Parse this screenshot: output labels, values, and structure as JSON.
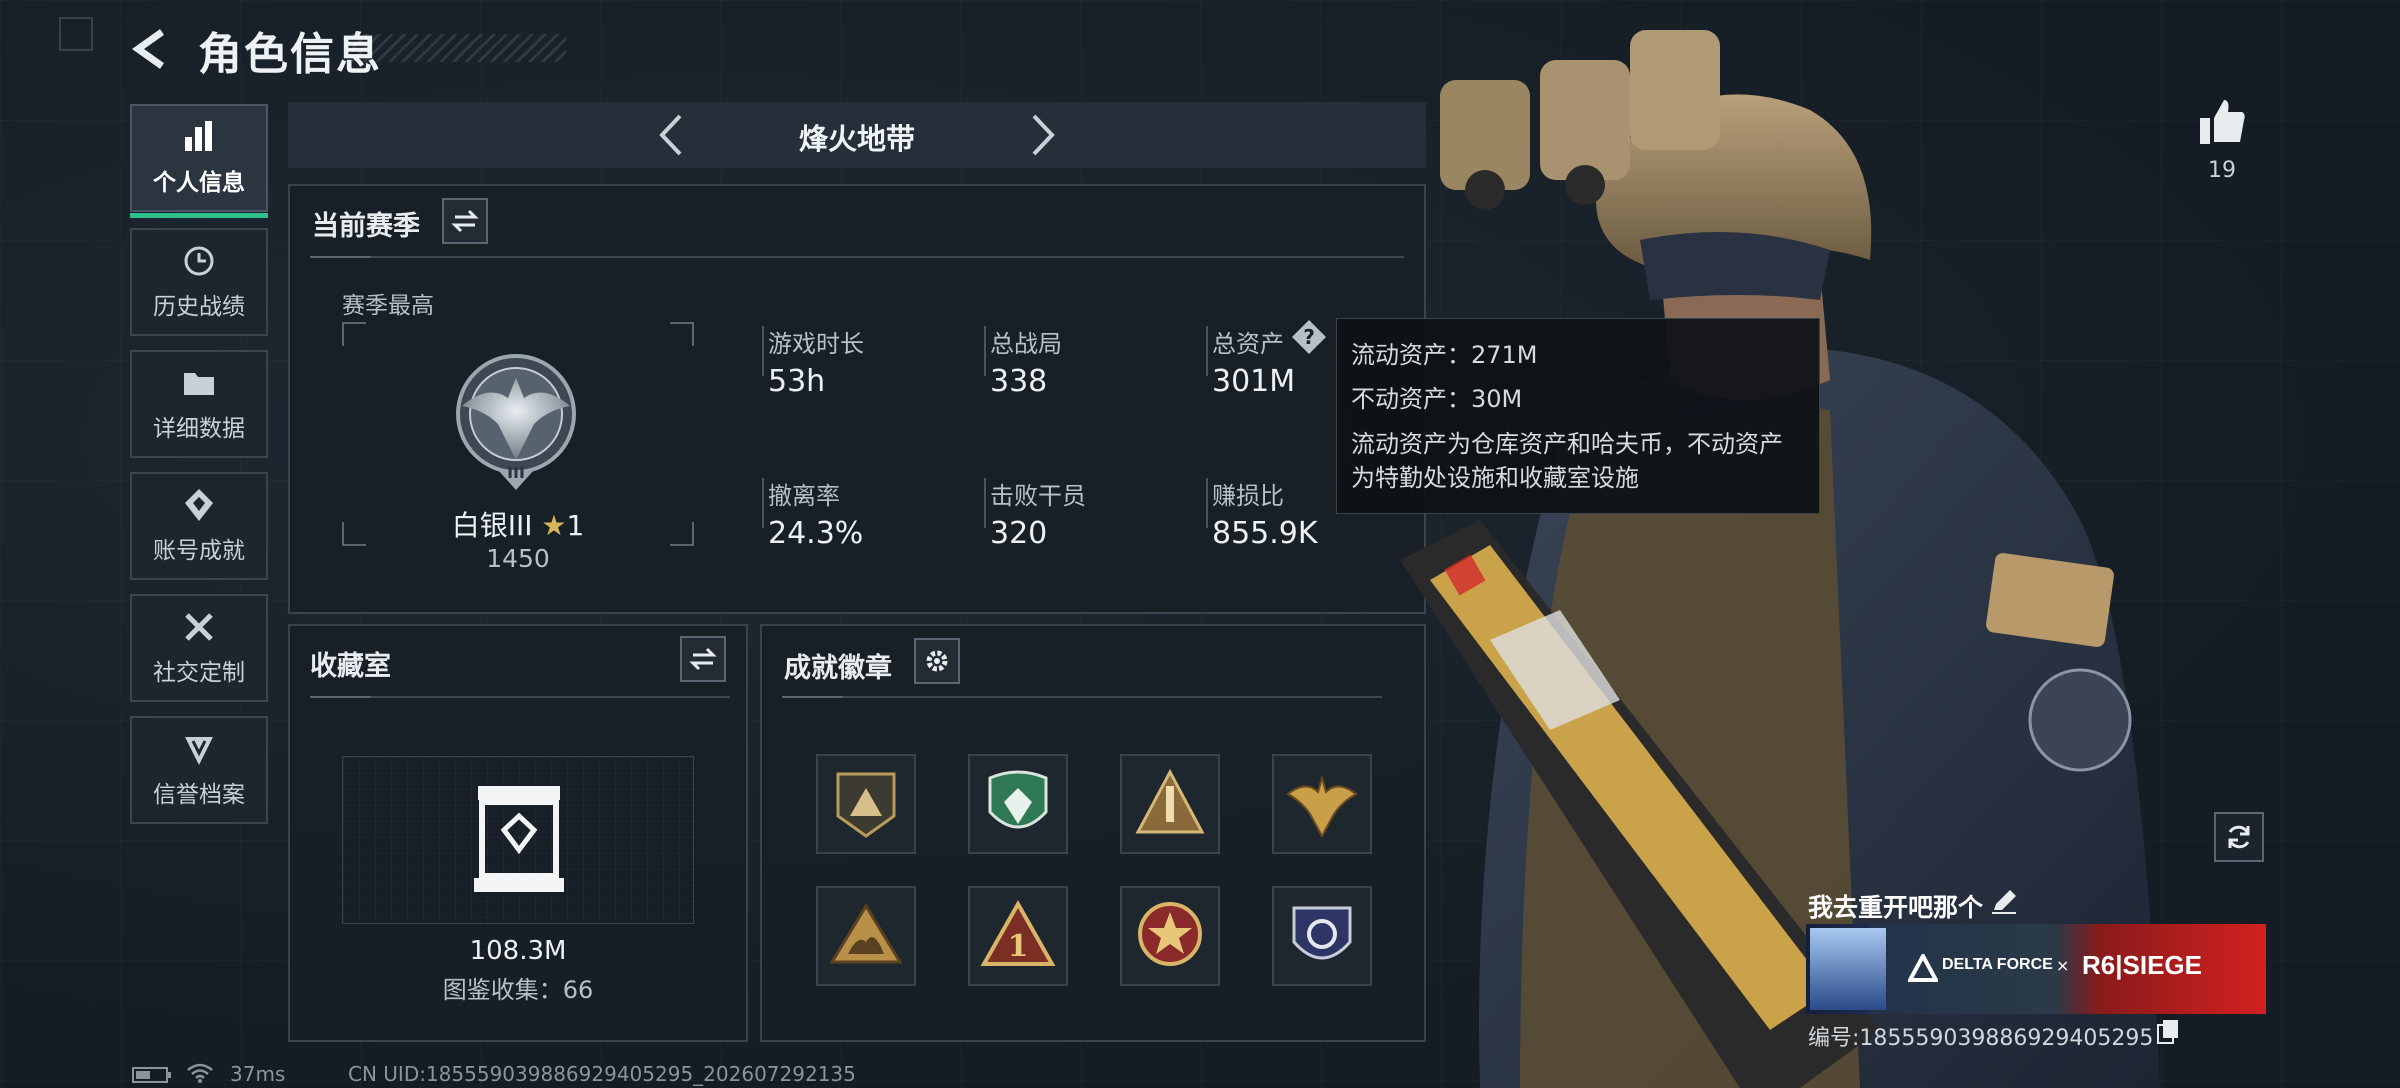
{
  "header": {
    "title": "角色信息"
  },
  "sidebar": {
    "items": [
      {
        "label": "个人信息",
        "icon": "bar-chart-icon",
        "active": true
      },
      {
        "label": "历史战绩",
        "icon": "history-clock-icon"
      },
      {
        "label": "详细数据",
        "icon": "folder-icon"
      },
      {
        "label": "账号成就",
        "icon": "achievement-icon"
      },
      {
        "label": "社交定制",
        "icon": "tools-icon"
      },
      {
        "label": "信誉档案",
        "icon": "shield-v-icon"
      }
    ]
  },
  "mode": {
    "title": "烽火地带"
  },
  "season": {
    "title": "当前赛季",
    "best_label": "赛季最高",
    "rank_name": "白银III",
    "rank_stars": "1",
    "rank_score": "1450",
    "stats": [
      {
        "label": "游戏时长",
        "value": "53h"
      },
      {
        "label": "总战局",
        "value": "338"
      },
      {
        "label": "总资产",
        "value": "301M"
      },
      {
        "label": "撤离率",
        "value": "24.3%"
      },
      {
        "label": "击败干员",
        "value": "320"
      },
      {
        "label": "赚损比",
        "value": "855.9K"
      }
    ]
  },
  "tooltip": {
    "liquid": "流动资产：271M",
    "fixed": "不动资产：30M",
    "desc_line1": "流动资产为仓库资产和哈夫币，不动资产",
    "desc_line2": "为特勤处设施和收藏室设施"
  },
  "collection": {
    "title": "收藏室",
    "value": "108.3M",
    "count": "图鉴收集：66"
  },
  "badges": {
    "title": "成就徽章",
    "items": [
      "delta-triangle-badge",
      "green-shield-badge",
      "rocket-badge",
      "eagle-badge",
      "camel-badge",
      "number-one-badge",
      "star-medal-badge",
      "blue-shield-badge"
    ]
  },
  "likes": {
    "count": "19"
  },
  "player": {
    "name": "我去重开吧那个",
    "id": "编号:1855590398869294052​95",
    "banner_text_1": "DELTA FORCE",
    "banner_x": "×",
    "banner_text_2": "R6|SIEGE"
  },
  "footer": {
    "ping": "37ms",
    "uid": "CN UID:18555903988692940529​5_202607292135"
  },
  "colors": {
    "accent": "#2fc08a",
    "gold": "#c9a24a"
  }
}
